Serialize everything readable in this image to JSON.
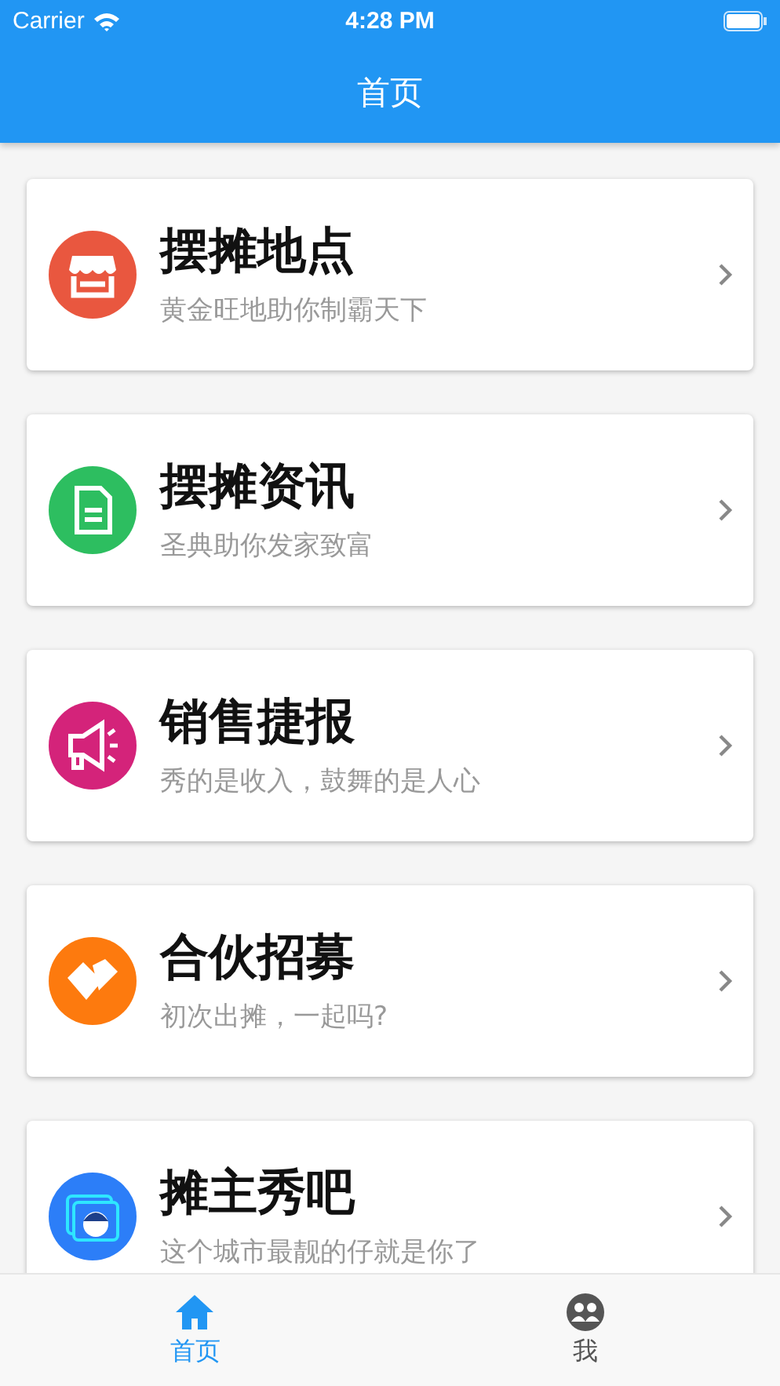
{
  "status_bar": {
    "carrier": "Carrier",
    "time": "4:28 PM"
  },
  "nav_bar": {
    "title": "首页"
  },
  "items": [
    {
      "kind": "store",
      "color": "#e9573f",
      "title": "摆摊地点",
      "subtitle": "黄金旺地助你制霸天下"
    },
    {
      "kind": "document",
      "color": "#2dbe60",
      "title": "摆摊资讯",
      "subtitle": "圣典助你发家致富"
    },
    {
      "kind": "megaphone",
      "color": "#d4237a",
      "title": "销售捷报",
      "subtitle": "秀的是收入，鼓舞的是人心"
    },
    {
      "kind": "handshake",
      "color": "#fd7a0e",
      "title": "合伙招募",
      "subtitle": "初次出摊，一起吗?"
    },
    {
      "kind": "avatar",
      "color": "#2c7ef8",
      "title": "摊主秀吧",
      "subtitle": "这个城市最靓的仔就是你了"
    }
  ],
  "tab_bar": [
    {
      "kind": "home",
      "label": "首页",
      "selected": true
    },
    {
      "kind": "people",
      "label": "我",
      "selected": false
    }
  ]
}
